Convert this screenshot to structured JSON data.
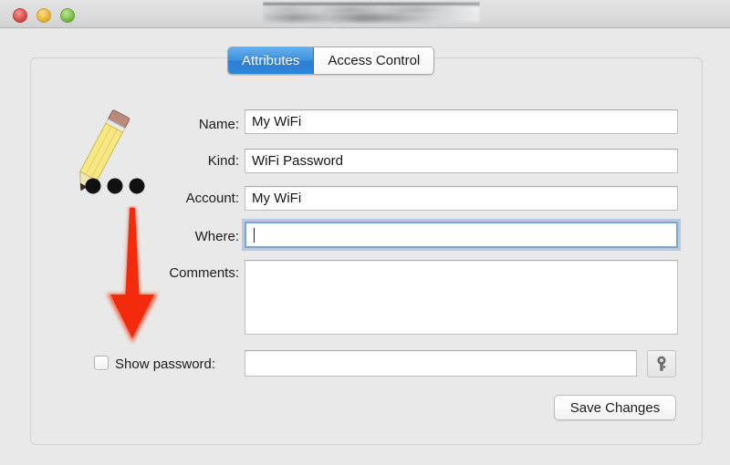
{
  "window": {
    "title_redacted": true,
    "traffic_lights": [
      {
        "name": "close",
        "color": "#d9534f"
      },
      {
        "name": "minimize",
        "color": "#e8b93a"
      },
      {
        "name": "zoom",
        "color": "#7fc24a"
      }
    ]
  },
  "tabs": [
    {
      "label": "Attributes",
      "active": true
    },
    {
      "label": "Access Control",
      "active": false
    }
  ],
  "item_icon": {
    "name": "pencil-password-icon",
    "pencil_color": "#f5e27a",
    "dots_color": "#111111",
    "dot_count": 3
  },
  "annotation": {
    "name": "red-down-arrow",
    "color": "#f32a0c",
    "points_to": "show-password-checkbox"
  },
  "form": {
    "fields": [
      {
        "label": "Name:",
        "value": "My WiFi",
        "focused": false
      },
      {
        "label": "Kind:",
        "value": "WiFi Password",
        "focused": false
      },
      {
        "label": "Account:",
        "value": "My WiFi",
        "focused": false
      },
      {
        "label": "Where:",
        "value": "",
        "focused": true
      }
    ],
    "comments": {
      "label": "Comments:",
      "value": ""
    },
    "show_password": {
      "label": "Show password:",
      "checked": false,
      "value": ""
    }
  },
  "buttons": {
    "key": {
      "label": "",
      "icon": "key-icon"
    },
    "save": {
      "label": "Save Changes"
    }
  },
  "colors": {
    "accent_blue": "#3f92e0",
    "annotation_red": "#f32a0c",
    "window_bg": "#e9e9e9",
    "focus_ring": "#7fa5cd"
  }
}
